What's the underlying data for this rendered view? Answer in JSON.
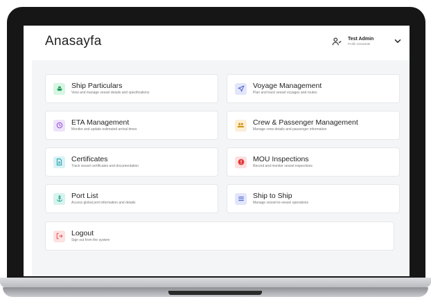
{
  "header": {
    "title": "Anasayfa",
    "user_name": "Test Admin",
    "user_role": "Profili Görüntüle"
  },
  "cards": [
    {
      "title": "Ship Particulars",
      "subtitle": "View and manage vessel details and specifications",
      "icon": "ship-icon",
      "color": "#1f9d55"
    },
    {
      "title": "Voyage Management",
      "subtitle": "Plan and track vessel voyages and routes",
      "icon": "navigation-icon",
      "color": "#4b5fd1"
    },
    {
      "title": "ETA Management",
      "subtitle": "Monitor and update estimated arrival times",
      "icon": "clock-icon",
      "color": "#8b4fd1"
    },
    {
      "title": "Crew & Passenger Management",
      "subtitle": "Manage crew details and passenger information",
      "icon": "users-icon",
      "color": "#d1900f"
    },
    {
      "title": "Certificates",
      "subtitle": "Track vessel certificates and documentation",
      "icon": "document-icon",
      "color": "#1a97a8"
    },
    {
      "title": "MOU Inspections",
      "subtitle": "Record and monitor vessel inspections",
      "icon": "alert-icon",
      "color": "#e03a3a"
    },
    {
      "title": "Port List",
      "subtitle": "Access global port information and details",
      "icon": "anchor-icon",
      "color": "#159d85"
    },
    {
      "title": "Ship to Ship",
      "subtitle": "Manage vessel-to-vessel operations",
      "icon": "list-icon",
      "color": "#4b66d1"
    },
    {
      "title": "Logout",
      "subtitle": "Sign out from the system",
      "icon": "logout-icon",
      "color": "#d9534f"
    }
  ]
}
